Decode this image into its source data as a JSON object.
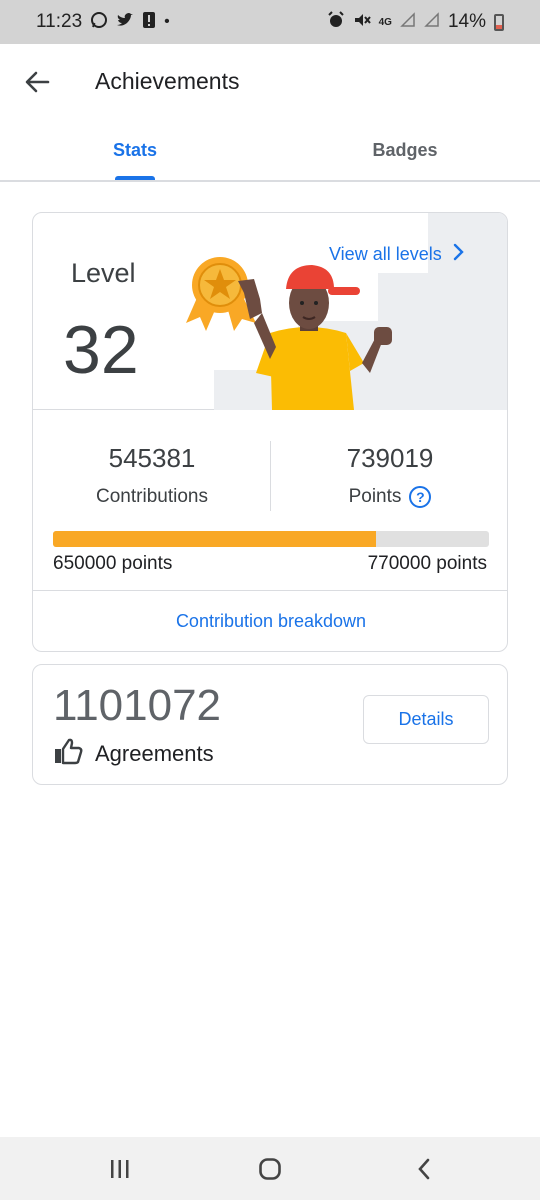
{
  "status_bar": {
    "time": "11:23",
    "battery": "14%",
    "left_icons": [
      "whatsapp-icon",
      "twitter-icon",
      "alert-icon",
      "dot-icon"
    ],
    "right_icons": [
      "alarm-icon",
      "mute-icon",
      "4g-icon",
      "signal-icon",
      "signal-icon-2",
      "battery-icon"
    ]
  },
  "appbar": {
    "title": "Achievements",
    "back_icon": "back-arrow-icon"
  },
  "tabs": [
    {
      "label": "Stats",
      "active": true
    },
    {
      "label": "Badges",
      "active": false
    }
  ],
  "level_card": {
    "level_label": "Level",
    "level_number": "32",
    "view_all_label": "View all levels",
    "contributions_value": "545381",
    "contributions_label": "Contributions",
    "points_value": "739019",
    "points_label": "Points",
    "progress_min": "650000 points",
    "progress_max": "770000 points",
    "progress_fraction": 0.74,
    "breakdown_label": "Contribution breakdown"
  },
  "agreements_card": {
    "count": "1101072",
    "label": "Agreements",
    "details_label": "Details"
  },
  "colors": {
    "accent": "#1a73e8",
    "progress": "#f9a825",
    "status_bar_bg": "#d3d3d3"
  }
}
